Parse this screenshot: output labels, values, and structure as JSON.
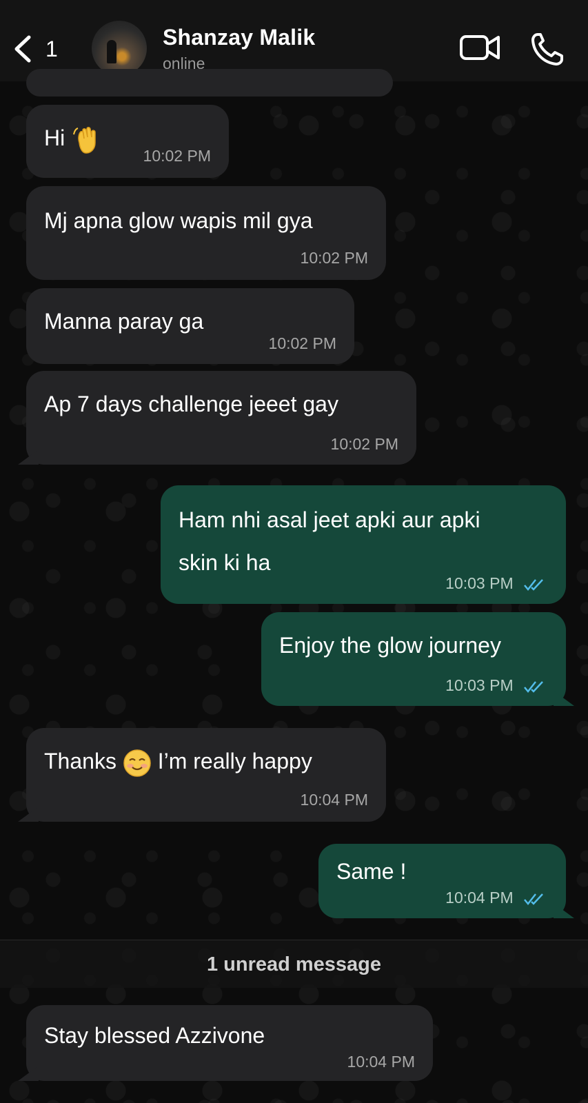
{
  "header": {
    "back_count": "1",
    "contact_name": "Shanzay Malik",
    "contact_status": "online",
    "icons": [
      "chevron-left-icon",
      "video-call-icon",
      "phone-icon"
    ]
  },
  "messages": [
    {
      "direction": "incoming",
      "text": "Hi",
      "emoji": "waving-hand",
      "time": "10:02 PM"
    },
    {
      "direction": "incoming",
      "text": "Mj apna glow wapis mil gya",
      "time": "10:02 PM"
    },
    {
      "direction": "incoming",
      "text": "Manna paray ga",
      "time": "10:02 PM"
    },
    {
      "direction": "incoming",
      "text": "Ap 7 days challenge jeeet gay",
      "time": "10:02 PM"
    },
    {
      "direction": "outgoing",
      "line1": "Ham nhi asal jeet apki aur apki",
      "line2": "skin ki ha",
      "time": "10:03 PM",
      "status": "read"
    },
    {
      "direction": "outgoing",
      "text": "Enjoy the glow journey",
      "time": "10:03 PM",
      "status": "read"
    },
    {
      "direction": "incoming",
      "text_before": "Thanks",
      "emoji": "smiling-face",
      "text_after": "I’m really happy",
      "time": "10:04 PM"
    },
    {
      "direction": "outgoing",
      "text": "Same !",
      "time": "10:04 PM",
      "status": "read"
    },
    {
      "direction": "incoming",
      "text": "Stay blessed Azzivone",
      "time": "10:04 PM"
    }
  ],
  "unread_divider": "1 unread message",
  "colors": {
    "incoming_bubble": "#242426",
    "outgoing_bubble": "#15483a",
    "read_ticks": "#53bdeb",
    "header_bg": "#141414"
  }
}
